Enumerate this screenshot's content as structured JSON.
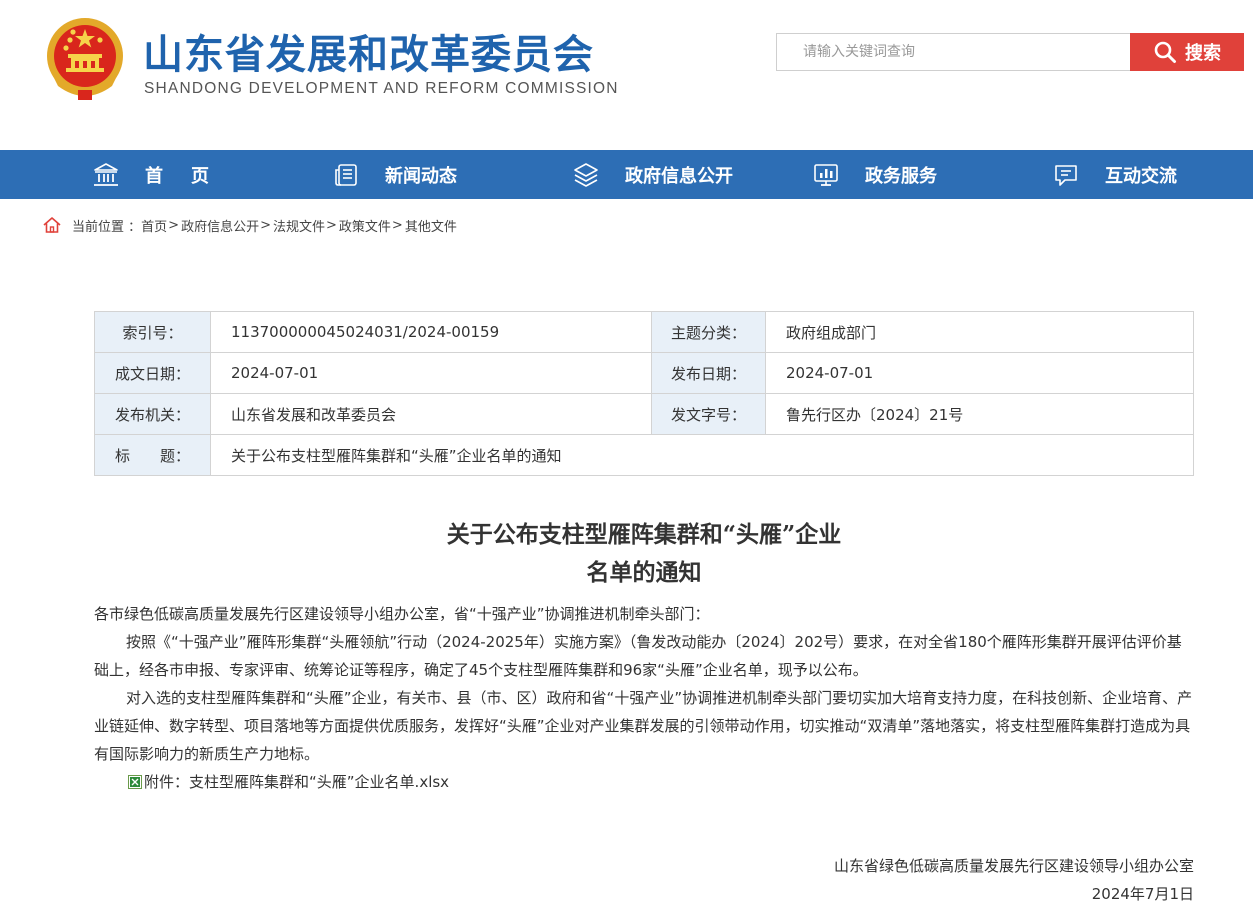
{
  "header": {
    "title": "山东省发展和改革委员会",
    "subtitle": "SHANDONG DEVELOPMENT AND REFORM COMMISSION",
    "emblem_icon": "national-emblem",
    "brand_color": "#1f63ad"
  },
  "search": {
    "placeholder": "请输入关键词查询",
    "button_label": "搜索",
    "button_icon": "search-icon",
    "button_color": "#e0413a"
  },
  "nav": {
    "color": "#2d6eb5",
    "items": [
      {
        "label": "首页",
        "icon": "bank-icon"
      },
      {
        "label": "新闻动态",
        "icon": "news-icon"
      },
      {
        "label": "政府信息公开",
        "icon": "layers-icon"
      },
      {
        "label": "政务服务",
        "icon": "chart-monitor-icon"
      },
      {
        "label": "互动交流",
        "icon": "chat-icon"
      }
    ]
  },
  "breadcrumb": {
    "prefix": "当前位置 ：",
    "items": [
      "首页",
      "政府信息公开",
      "法规文件",
      "政策文件",
      "其他文件"
    ],
    "separator": ">"
  },
  "info": {
    "index_label": "索引号：",
    "index_value": "113700000045024031/2024-00159",
    "topic_label": "主题分类：",
    "topic_value": "政府组成部门",
    "written_label": "成文日期：",
    "written_value": "2024-07-01",
    "published_label": "发布日期：",
    "published_value": "2024-07-01",
    "issuer_label": "发布机关：",
    "issuer_value": "山东省发展和改革委员会",
    "docno_label": "发文字号：",
    "docno_value": "鲁先行区办〔2024〕21号",
    "title_label": "标　　题：",
    "title_value": "关于公布支柱型雁阵集群和“头雁”企业名单的通知"
  },
  "article": {
    "title_line1": "关于公布支柱型雁阵集群和“头雁”企业",
    "title_line2": "名单的通知",
    "salutation": "各市绿色低碳高质量发展先行区建设领导小组办公室，省“十强产业”协调推进机制牵头部门：",
    "para1": "按照《“十强产业”雁阵形集群“头雁领航”行动（2024-2025年）实施方案》（鲁发改动能办〔2024〕202号）要求，在对全省180个雁阵形集群开展评估评价基础上，经各市申报、专家评审、统筹论证等程序，确定了45个支柱型雁阵集群和96家“头雁”企业名单，现予以公布。",
    "para2": "对入选的支柱型雁阵集群和“头雁”企业，有关市、县（市、区）政府和省“十强产业”协调推进机制牵头部门要切实加大培育支持力度，在科技创新、企业培育、产业链延伸、数字转型、项目落地等方面提供优质服务，发挥好“头雁”企业对产业集群发展的引领带动作用，切实推动“双清单”落地落实，将支柱型雁阵集群打造成为具有国际影响力的新质生产力地标。",
    "attachment_label": "附件：",
    "attachment_name": "支柱型雁阵集群和“头雁”企业名单.xlsx",
    "attachment_icon": "excel-file-icon",
    "signature_org": "山东省绿色低碳高质量发展先行区建设领导小组办公室",
    "signature_date": "2024年7月1日"
  }
}
